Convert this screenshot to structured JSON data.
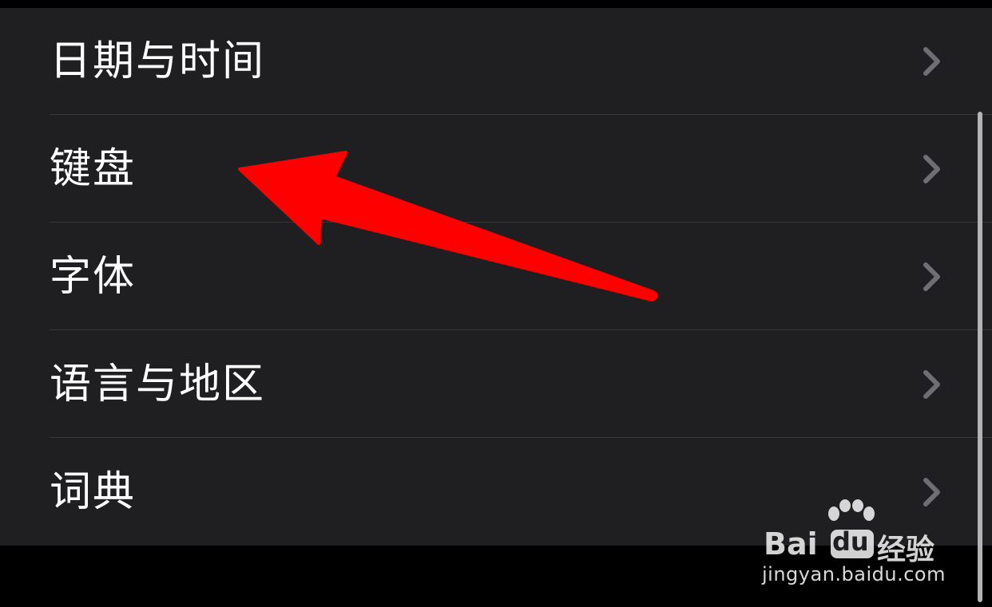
{
  "settings": {
    "items": [
      {
        "label": "日期与时间"
      },
      {
        "label": "键盘"
      },
      {
        "label": "字体"
      },
      {
        "label": "语言与地区"
      },
      {
        "label": "词典"
      }
    ]
  },
  "annotation": {
    "arrow_color": "#ff0000",
    "points_to": "键盘"
  },
  "watermark": {
    "brand": "Bai",
    "brand_box": "du",
    "product": "经验",
    "url": "jingyan.baidu.com"
  },
  "colors": {
    "background": "#1f1f21",
    "text": "#ffffff",
    "separator": "#38383b",
    "chevron": "#6e6e73"
  }
}
